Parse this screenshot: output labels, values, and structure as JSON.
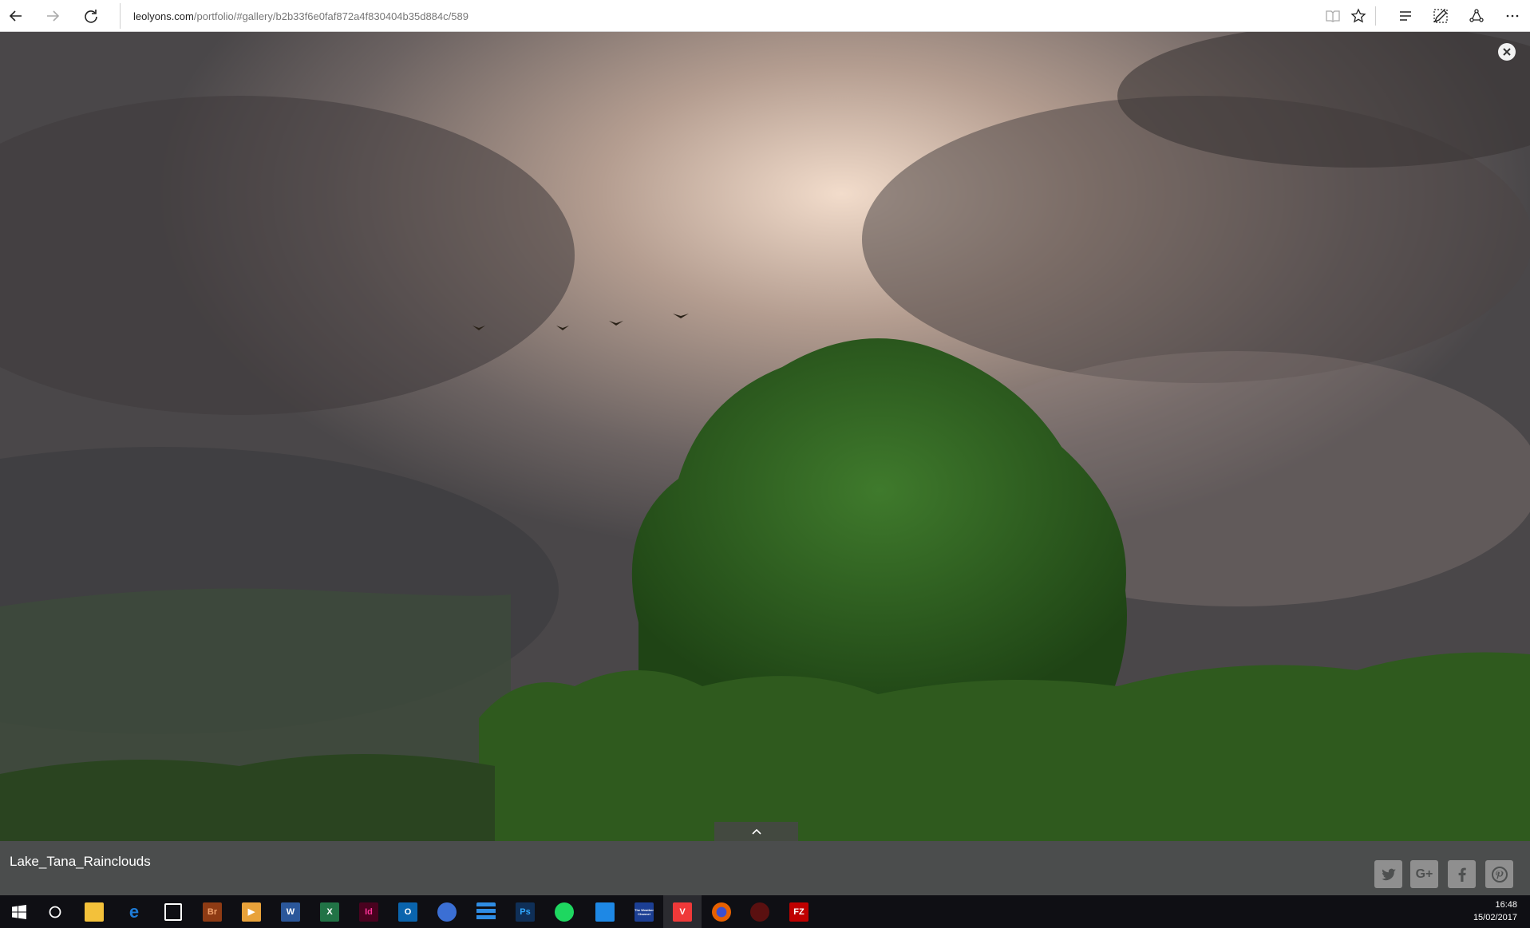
{
  "browser": {
    "url_domain": "leolyons.com",
    "url_path": "/portfolio/#gallery/b2b33f6e0faf872a4f830404b35d884c/589",
    "icons": [
      "back-arrow-icon",
      "forward-arrow-icon",
      "refresh-icon",
      "reading-view-icon",
      "favorite-star-icon",
      "hub-icon",
      "web-note-icon",
      "share-icon",
      "more-icon"
    ]
  },
  "gallery": {
    "caption": "Lake_Tana_Rainclouds",
    "close_icon": "close-icon",
    "expand_icon": "chevron-up-icon",
    "share_buttons": [
      "twitter-icon",
      "google-plus-icon",
      "facebook-icon",
      "pinterest-icon"
    ],
    "google_plus_label": "G+"
  },
  "taskbar": {
    "apps": [
      {
        "name": "start-icon",
        "label": "",
        "color": "#ffffff"
      },
      {
        "name": "cortana-icon",
        "label": "",
        "color": "#ffffff"
      },
      {
        "name": "file-explorer-icon",
        "label": "",
        "color": "#f3c13a"
      },
      {
        "name": "edge-icon",
        "label": "e",
        "color": "#1e7bd6"
      },
      {
        "name": "store-icon",
        "label": "",
        "color": "#ffffff"
      },
      {
        "name": "bridge-icon",
        "label": "Br",
        "color": "#8e3b14"
      },
      {
        "name": "media-player-icon",
        "label": "▶",
        "color": "#e8a23a"
      },
      {
        "name": "word-icon",
        "label": "W",
        "color": "#2b579a"
      },
      {
        "name": "excel-icon",
        "label": "X",
        "color": "#217346"
      },
      {
        "name": "indesign-icon",
        "label": "Id",
        "color": "#8a1658"
      },
      {
        "name": "outlook-icon",
        "label": "O",
        "color": "#0a64ad"
      },
      {
        "name": "keepass-icon",
        "label": "",
        "color": "#3b6fd4"
      },
      {
        "name": "stack-app-icon",
        "label": "",
        "color": "#2f8de4"
      },
      {
        "name": "photoshop-icon",
        "label": "Ps",
        "color": "#0f2f57"
      },
      {
        "name": "spotify-icon",
        "label": "",
        "color": "#1ed760"
      },
      {
        "name": "messenger-icon",
        "label": "",
        "color": "#1e88e5"
      },
      {
        "name": "weather-channel-icon",
        "label": "The Weather Channel",
        "color": "#1c3f94"
      },
      {
        "name": "vivaldi-icon",
        "label": "V",
        "color": "#ef3939"
      },
      {
        "name": "firefox-icon",
        "label": "",
        "color": "#e66000"
      },
      {
        "name": "gpu-monitor-icon",
        "label": "",
        "color": "#5a1010"
      },
      {
        "name": "filezilla-icon",
        "label": "FZ",
        "color": "#bf0000"
      }
    ],
    "time": "16:48",
    "date": "15/02/2017"
  }
}
